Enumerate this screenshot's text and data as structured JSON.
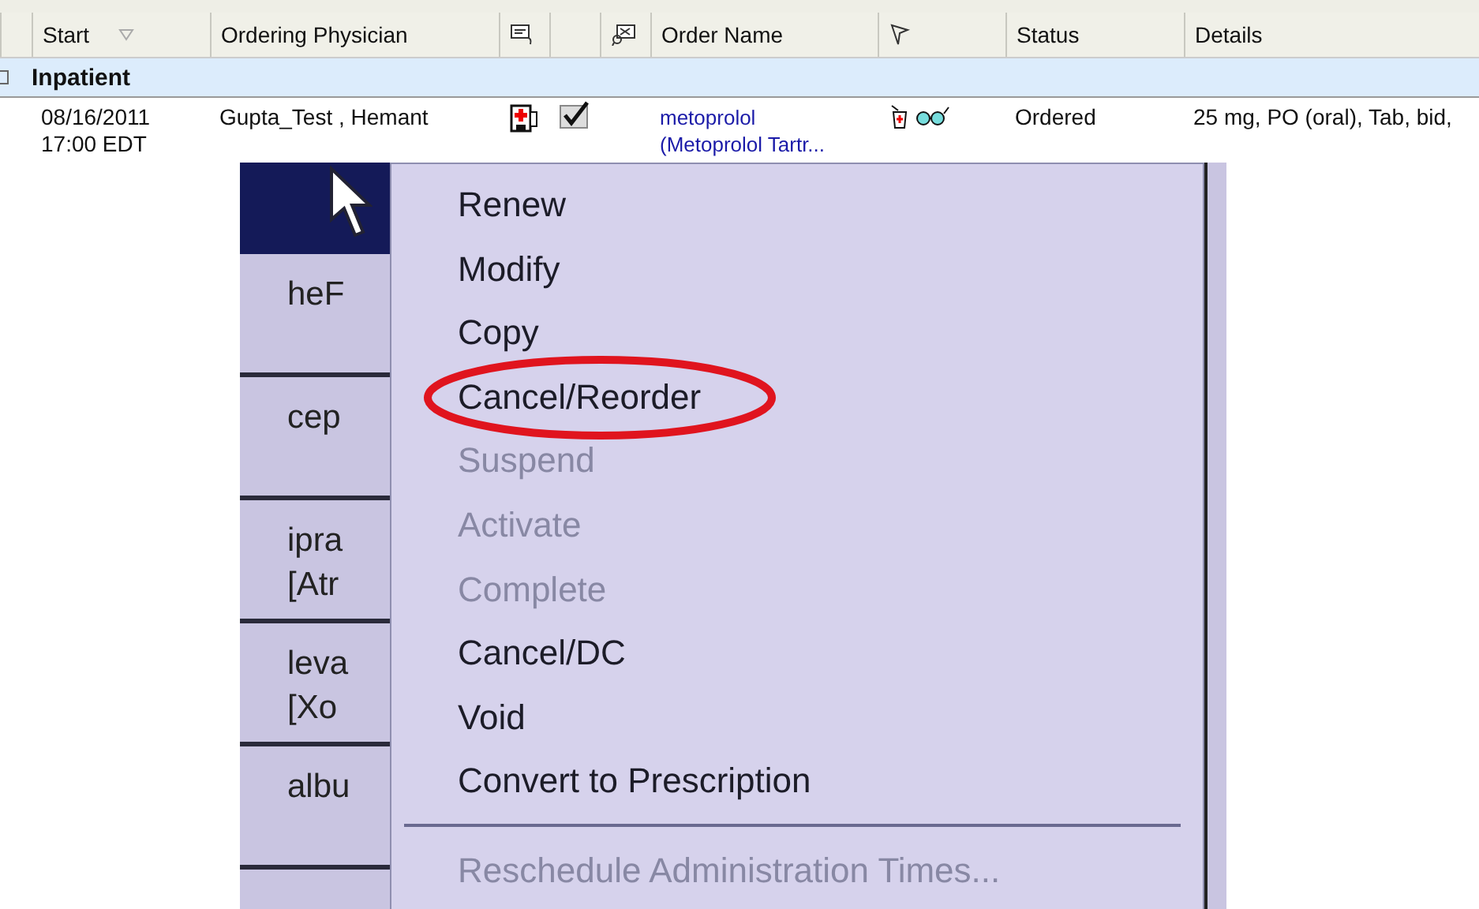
{
  "table": {
    "columns": [
      {
        "kind": "text",
        "label": "Start",
        "sorted": true
      },
      {
        "kind": "text",
        "label": "Ordering Physician"
      },
      {
        "kind": "icon"
      },
      {
        "kind": "blank"
      },
      {
        "kind": "icon"
      },
      {
        "kind": "text",
        "label": "Order Name"
      },
      {
        "kind": "icon"
      },
      {
        "kind": "text",
        "label": "Status"
      },
      {
        "kind": "text",
        "label": "Details"
      }
    ],
    "group": {
      "label": "Inpatient",
      "expanded": true
    },
    "row": {
      "start_date": "08/16/2011",
      "start_time": "17:00 EDT",
      "physician": "Gupta_Test , Hemant",
      "checked": true,
      "order_name": "metoprolol",
      "order_name_2": "(Metoprolol Tartr...",
      "status": "Ordered",
      "details": "25 mg, PO (oral), Tab, bid,"
    }
  },
  "photo": {
    "row_stubs": [
      {
        "lines": [
          "heF"
        ]
      },
      {
        "lines": [
          "cep"
        ]
      },
      {
        "lines": [
          "ipra",
          "[Atr"
        ]
      },
      {
        "lines": [
          "leva",
          "[Xo"
        ]
      },
      {
        "lines": [
          "albu"
        ]
      }
    ],
    "menu": [
      {
        "label": "Renew",
        "disabled": false,
        "highlighted": false
      },
      {
        "label": "Modify",
        "disabled": false,
        "highlighted": false
      },
      {
        "label": "Copy",
        "disabled": false,
        "highlighted": false
      },
      {
        "label": "Cancel/Reorder",
        "disabled": false,
        "highlighted": true
      },
      {
        "label": "Suspend",
        "disabled": true,
        "highlighted": false
      },
      {
        "label": "Activate",
        "disabled": true,
        "highlighted": false
      },
      {
        "label": "Complete",
        "disabled": true,
        "highlighted": false
      },
      {
        "label": "Cancel/DC",
        "disabled": false,
        "highlighted": false
      },
      {
        "label": "Void",
        "disabled": false,
        "highlighted": false
      },
      {
        "label": "Convert to Prescription",
        "disabled": false,
        "highlighted": false
      },
      {
        "kind": "separator"
      },
      {
        "label": "Reschedule Administration Times...",
        "disabled": true,
        "highlighted": false
      }
    ]
  }
}
